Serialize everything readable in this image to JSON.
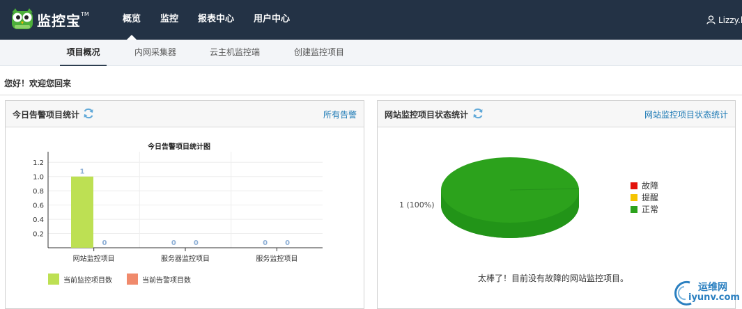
{
  "brand": {
    "name": "监控宝",
    "tm": "TM"
  },
  "nav": {
    "items": [
      "概览",
      "监控",
      "报表中心",
      "用户中心"
    ],
    "active": 0
  },
  "user": {
    "name": "Lizzy.l"
  },
  "subnav": {
    "items": [
      "项目概况",
      "内网采集器",
      "云主机监控端",
      "创建监控项目"
    ],
    "active": 0
  },
  "greeting": "您好！欢迎您回来",
  "alert_panel": {
    "title": "今日告警项目统计",
    "link": "所有告警",
    "chart_title": "今日告警项目统计图",
    "legend": [
      "当前监控项目数",
      "当前告警项目数"
    ]
  },
  "status_panel": {
    "title": "网站监控项目状态统计",
    "link": "网站监控项目状态统计",
    "pie_label": "1 (100%)",
    "legend": [
      "故障",
      "提醒",
      "正常"
    ],
    "message": "太棒了！目前没有故障的网站监控项目。"
  },
  "watermark": {
    "cn": "运维网",
    "en": "iyunv.com"
  },
  "colors": {
    "topbar": "#233245",
    "bar_monitor": "#bde053",
    "bar_alert": "#f08a6c",
    "fault": "#e3120b",
    "warn": "#f5c400",
    "normal": "#2ca21c",
    "link": "#1a78b4"
  },
  "chart_data": [
    {
      "type": "bar",
      "title": "今日告警项目统计图",
      "categories": [
        "网站监控项目",
        "服务器监控项目",
        "服务监控项目"
      ],
      "series": [
        {
          "name": "当前监控项目数",
          "values": [
            1,
            0,
            0
          ]
        },
        {
          "name": "当前告警项目数",
          "values": [
            0,
            0,
            0
          ]
        }
      ],
      "yticks": [
        "0.2",
        "0.4",
        "0.6",
        "0.8",
        "1.0",
        "1.2"
      ],
      "ylim": [
        0,
        1.3
      ],
      "grid": true,
      "legend": "bottom"
    },
    {
      "type": "pie",
      "slices": [
        {
          "name": "故障",
          "value": 0
        },
        {
          "name": "提醒",
          "value": 0
        },
        {
          "name": "正常",
          "value": 1
        }
      ],
      "legend": "right"
    }
  ]
}
